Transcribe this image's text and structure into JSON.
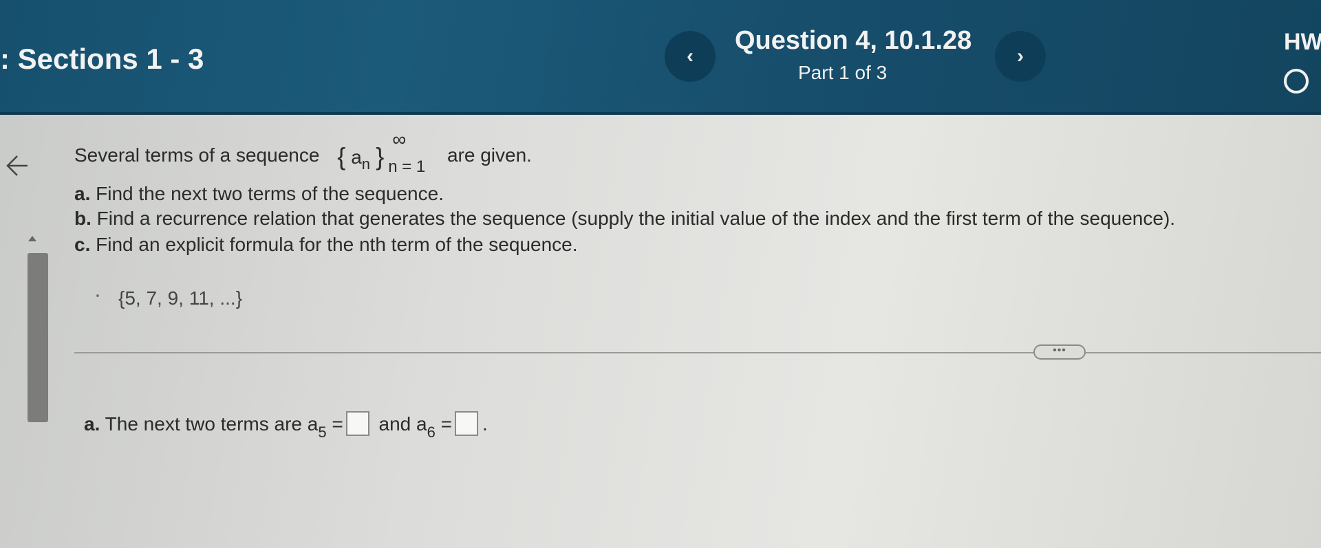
{
  "header": {
    "section_title": ": Sections 1 - 3",
    "question_title": "Question 4, 10.1.28",
    "part_label": "Part 1 of 3",
    "hw_label": "HW",
    "prev_label": "‹",
    "next_label": "›"
  },
  "problem": {
    "intro_prefix": "Several terms of a sequence",
    "seq_brace_left": "{",
    "seq_term": "a",
    "seq_term_sub": "n",
    "seq_brace_right": "}",
    "seq_upper": "∞",
    "seq_lower": "n = 1",
    "intro_suffix": "are given.",
    "part_a_letter": "a.",
    "part_a_text": "Find the next two terms of the sequence.",
    "part_b_letter": "b.",
    "part_b_text": "Find a recurrence relation that generates the sequence (supply the initial value of the index and the first term of the sequence).",
    "part_c_letter": "c.",
    "part_c_text": "Find an explicit formula for the nth term of the sequence.",
    "given_sequence": "{5, 7, 9, 11, ...}"
  },
  "more_button": "•••",
  "answer": {
    "letter": "a.",
    "prefix": "The next two terms are",
    "term1": "a",
    "term1_sub": "5",
    "equals": "=",
    "and": "and",
    "term2": "a",
    "term2_sub": "6",
    "end": "."
  },
  "icons": {
    "back": "left-arrow-icon",
    "scroll_up": "triangle-up-icon"
  },
  "colors": {
    "header_bg": "#1c5a7a",
    "nav_button_bg": "#0e3d57",
    "page_bg": "#dcdcda"
  }
}
